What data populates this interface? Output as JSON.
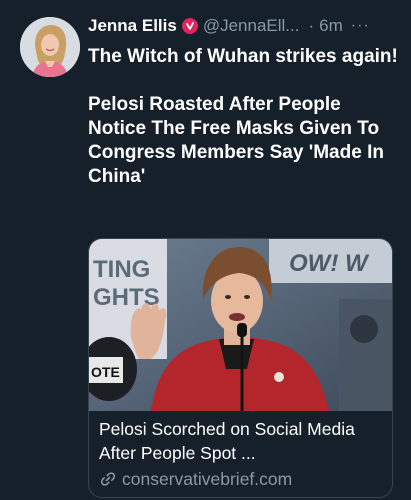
{
  "tweet": {
    "author_name": "Jenna Ellis",
    "verified_icon": "verified-badge-icon",
    "handle": "@JennaEll...",
    "separator": "·",
    "time": "6m",
    "more": "···",
    "text_line1": "The Witch of Wuhan strikes again!",
    "text_line2": "Pelosi Roasted After People Notice The Free Masks Given To Congress Members Say 'Made In China'"
  },
  "card": {
    "image_sign_text": "TING GHTS",
    "image_banner_text": "OW! W",
    "image_mask_text": "OTE",
    "title": "Pelosi Scorched on Social Media After People Spot ...",
    "domain": "conservativebrief.com",
    "link_icon": "link-icon"
  },
  "colors": {
    "background": "#15202b",
    "secondary_text": "#8899a6",
    "border": "#38444d",
    "verified_badge": "#e0245e"
  }
}
